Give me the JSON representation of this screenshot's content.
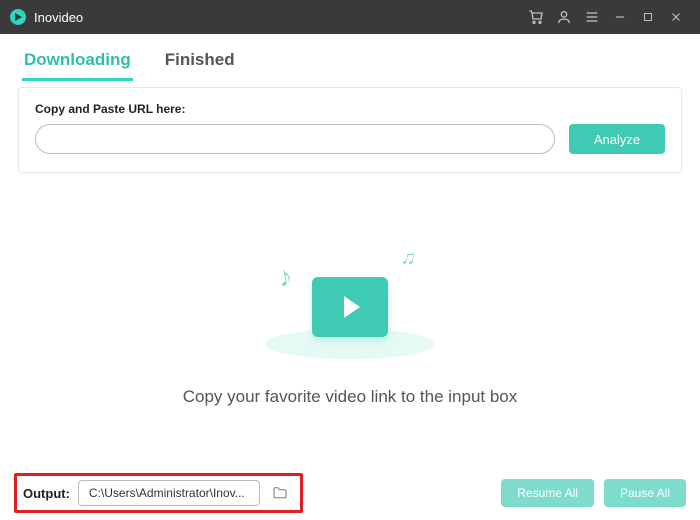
{
  "titlebar": {
    "app_name": "Inovideo",
    "icons": {
      "cart": "cart-icon",
      "account": "account-icon",
      "menu": "menu-icon",
      "minimize": "minimize-icon",
      "maximize": "maximize-icon",
      "close": "close-icon"
    }
  },
  "tabs": {
    "downloading": "Downloading",
    "finished": "Finished",
    "active": "downloading"
  },
  "url_card": {
    "label": "Copy and Paste URL here:",
    "input_value": "",
    "analyze_label": "Analyze"
  },
  "empty": {
    "message": "Copy your favorite video link to the input box"
  },
  "bottom": {
    "output_label": "Output:",
    "output_path": "C:\\Users\\Administrator\\Inov...",
    "resume_label": "Resume All",
    "pause_label": "Pause All"
  },
  "colors": {
    "accent": "#3fcab3",
    "highlight_border": "#e02020"
  }
}
